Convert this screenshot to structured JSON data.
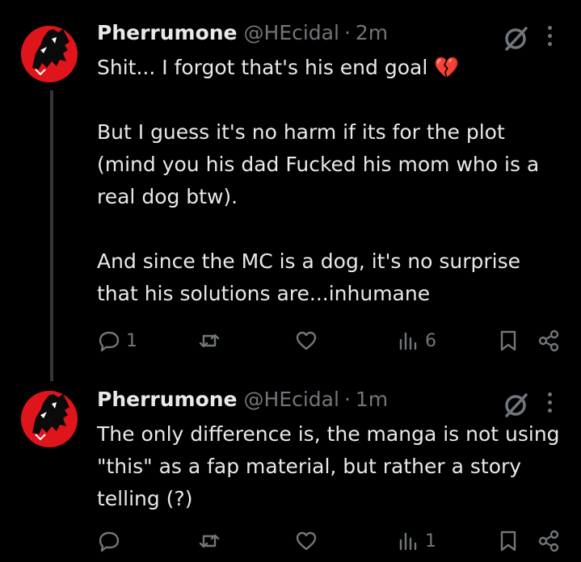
{
  "tweets": [
    {
      "author_name": "Pherrumone",
      "author_handle": "@HEcidal",
      "separator": "·",
      "time": "2m",
      "paragraphs": [
        "Shit... I forgot that's his end goal 💔",
        "But I guess it's no harm if its for the plot (mind you his dad Fucked his mom who is a real dog btw).",
        "And since the MC is a dog, it's no surprise that his solutions are...inhumane"
      ],
      "reply_count": "1",
      "repost_count": "",
      "like_count": "",
      "view_count": "6"
    },
    {
      "author_name": "Pherrumone",
      "author_handle": "@HEcidal",
      "separator": "·",
      "time": "1m",
      "paragraphs": [
        "The only difference is, the manga is not using \"this\" as a fap material, but rather a story telling (?)"
      ],
      "reply_count": "",
      "repost_count": "",
      "like_count": "",
      "view_count": "1"
    }
  ],
  "colors": {
    "background": "#000000",
    "text": "#e7e9ea",
    "muted": "#71767b",
    "avatar_red": "#e0151c"
  },
  "icons": [
    "avatar",
    "grok-icon",
    "more-icon",
    "reply-icon",
    "repost-icon",
    "like-icon",
    "views-icon",
    "bookmark-icon",
    "share-icon"
  ]
}
